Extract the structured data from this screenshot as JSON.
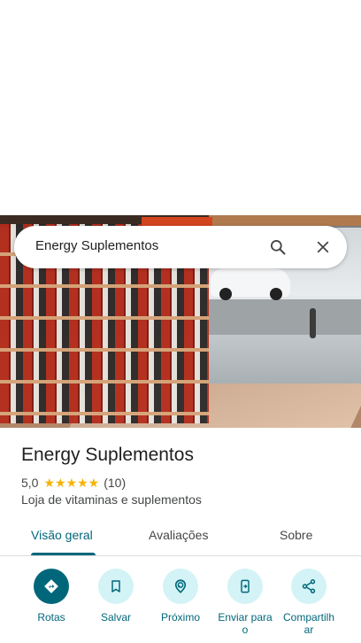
{
  "search": {
    "query": "Energy Suplementos"
  },
  "place": {
    "name": "Energy Suplementos",
    "rating": "5,0",
    "stars": "★★★★★",
    "review_count": "(10)",
    "category": "Loja de vitaminas e suplementos"
  },
  "tabs": [
    {
      "label": "Visão geral",
      "active": true
    },
    {
      "label": "Avaliações",
      "active": false
    },
    {
      "label": "Sobre",
      "active": false
    }
  ],
  "actions": [
    {
      "label": "Rotas",
      "icon": "directions-icon"
    },
    {
      "label": "Salvar",
      "icon": "bookmark-icon"
    },
    {
      "label": "Próximo",
      "icon": "nearby-icon"
    },
    {
      "label": "Enviar para o",
      "icon": "send-to-phone-icon"
    },
    {
      "label": "Compartilhar",
      "icon": "share-icon"
    }
  ],
  "colors": {
    "accent": "#00677a",
    "accent_light": "#d3f3f6",
    "star": "#f4b400",
    "text": "#1f1f1f",
    "secondary_text": "#444746"
  }
}
